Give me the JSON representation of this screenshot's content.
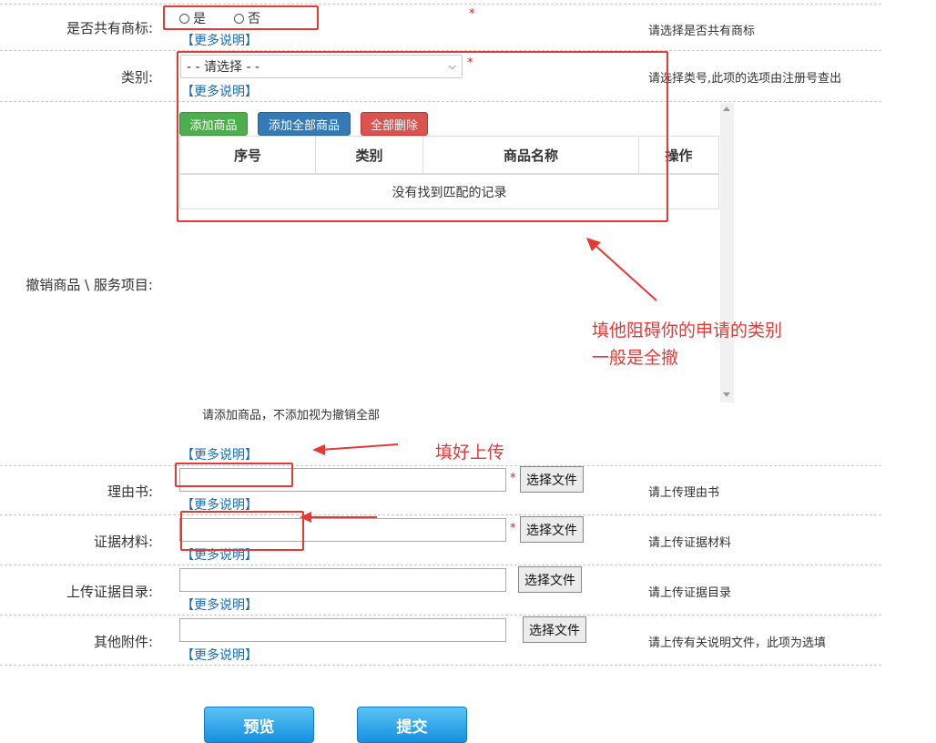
{
  "shared_mark": {
    "label": "是否共有商标:",
    "opt_yes": "是",
    "opt_no": "否",
    "star": "*",
    "hint": "请选择是否共有商标",
    "more": "【更多说明】"
  },
  "category": {
    "label": "类别:",
    "select_value": "- - 请选择 - -",
    "star": "*",
    "hint": "请选择类号,此项的选项由注册号查出",
    "more": "【更多说明】"
  },
  "goods": {
    "label": "撤销商品 \\ 服务项目:",
    "btn_add": "添加商品",
    "btn_add_all": "添加全部商品",
    "btn_delete_all": "全部删除",
    "columns": [
      "序号",
      "类别",
      "商品名称",
      "操作"
    ],
    "empty_text": "没有找到匹配的记录",
    "note": "请添加商品，不添加视为撤销全部",
    "more": "【更多说明】"
  },
  "annotations": {
    "text_line1": "填他阻碍你的申请的类别",
    "text_line2": "一般是全撤",
    "upload_text": "填好上传",
    "color": "#e53935"
  },
  "reason": {
    "label": "理由书:",
    "star": "*",
    "file_btn": "选择文件",
    "hint": "请上传理由书",
    "more": "【更多说明】"
  },
  "evidence": {
    "label": "证据材料:",
    "star": "*",
    "file_btn": "选择文件",
    "hint": "请上传证据材料",
    "more": "【更多说明】"
  },
  "evidence_index": {
    "label": "上传证据目录:",
    "file_btn": "选择文件",
    "hint": "请上传证据目录",
    "more": "【更多说明】"
  },
  "other": {
    "label": "其他附件:",
    "file_btn": "选择文件",
    "hint": "请上传有关说明文件，此项为选填",
    "more": "【更多说明】"
  },
  "actions": {
    "preview": "预览",
    "submit": "提交"
  }
}
